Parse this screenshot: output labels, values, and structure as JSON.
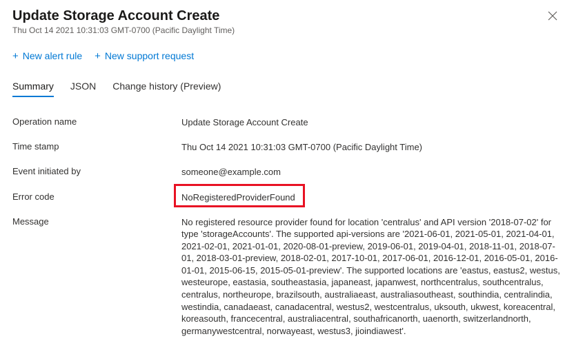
{
  "header": {
    "title": "Update Storage Account Create",
    "timestamp": "Thu Oct 14 2021 10:31:03 GMT-0700 (Pacific Daylight Time)"
  },
  "toolbar": {
    "new_alert_rule": "New alert rule",
    "new_support_request": "New support request"
  },
  "tabs": {
    "summary": "Summary",
    "json": "JSON",
    "change_history": "Change history (Preview)"
  },
  "details": {
    "labels": {
      "operation_name": "Operation name",
      "time_stamp": "Time stamp",
      "event_initiated_by": "Event initiated by",
      "error_code": "Error code",
      "message": "Message"
    },
    "values": {
      "operation_name": "Update Storage Account Create",
      "time_stamp": "Thu Oct 14 2021 10:31:03 GMT-0700 (Pacific Daylight Time)",
      "event_initiated_by": "someone@example.com",
      "error_code": "NoRegisteredProviderFound",
      "message": "No registered resource provider found for location 'centralus' and API version '2018-07-02' for type 'storageAccounts'. The supported api-versions are '2021-06-01, 2021-05-01, 2021-04-01, 2021-02-01, 2021-01-01, 2020-08-01-preview, 2019-06-01, 2019-04-01, 2018-11-01, 2018-07-01, 2018-03-01-preview, 2018-02-01, 2017-10-01, 2017-06-01, 2016-12-01, 2016-05-01, 2016-01-01, 2015-06-15, 2015-05-01-preview'. The supported locations are 'eastus, eastus2, westus, westeurope, eastasia, southeastasia, japaneast, japanwest, northcentralus, southcentralus, centralus, northeurope, brazilsouth, australiaeast, australiasoutheast, southindia, centralindia, westindia, canadaeast, canadacentral, westus2, westcentralus, uksouth, ukwest, koreacentral, koreasouth, francecentral, australiacentral, southafricanorth, uaenorth, switzerlandnorth, germanywestcentral, norwayeast, westus3, jioindiawest'."
    }
  },
  "colors": {
    "link": "#0078d4",
    "error_highlight": "#e81123"
  }
}
